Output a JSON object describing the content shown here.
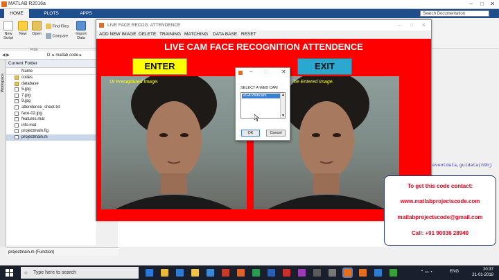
{
  "app": {
    "title": "MATLAB R2016a"
  },
  "ribbon": {
    "tabs": [
      "HOME",
      "PLOTS",
      "APPS"
    ],
    "search_placeholder": "Search Documentation",
    "buttons": [
      {
        "label": "New Script",
        "icon": "new-script-icon"
      },
      {
        "label": "New",
        "icon": "new-icon"
      },
      {
        "label": "Open",
        "icon": "open-folder-icon"
      },
      {
        "label": "Find Files",
        "icon": "find-files-icon"
      },
      {
        "label": "Compare",
        "icon": "compare-icon"
      },
      {
        "label": "Import Data",
        "icon": "import-data-icon"
      }
    ],
    "group_label": "FILE"
  },
  "address": {
    "path": "D: ▸ matlab code ▸"
  },
  "sidebar": {
    "workspace_tab": "Workspace"
  },
  "current_folder": {
    "title": "Current Folder",
    "column_header": "Name",
    "items": [
      {
        "name": "codes",
        "type": "folder"
      },
      {
        "name": "database",
        "type": "folder"
      },
      {
        "name": "5.jpg",
        "type": "file"
      },
      {
        "name": "7.jpg",
        "type": "file"
      },
      {
        "name": "9.jpg",
        "type": "file"
      },
      {
        "name": "attendence_sheet.txt",
        "type": "file"
      },
      {
        "name": "face-02.jpg",
        "type": "file"
      },
      {
        "name": "features.mat",
        "type": "file"
      },
      {
        "name": "info.mat",
        "type": "file"
      },
      {
        "name": "projectmain.fig",
        "type": "file"
      },
      {
        "name": "projectmain.m",
        "type": "file",
        "selected": true
      }
    ],
    "details": "projectmain.m  (Function)"
  },
  "command_window": {
    "code_text": ",eventdata,guidata(hObj"
  },
  "figure": {
    "title": "LIVE FACE RECOG. ATTENDENCE",
    "menu": [
      "ADD NEW IMAGE",
      "DELETE",
      "TRAINING",
      "MATCHING",
      "DATA BASE",
      "RESET"
    ],
    "heading": "LIVE CAM FACE RECOGNITION ATTENDENCE",
    "enter_label": "ENTER",
    "exit_label": "EXIT",
    "left_caption": "Ur Precaptured Image.",
    "right_caption": "he Entered Image.",
    "colors": {
      "canvas": "#ff0000",
      "enter": "#ffff00",
      "exit": "#2aa8d0",
      "caption": "#ffff33"
    }
  },
  "dialog": {
    "label": "SELECT A WEB CAM",
    "option": "VGA Webcam",
    "ok": "OK",
    "cancel": "Cancel"
  },
  "contact": {
    "line1": "To get this code contact:",
    "line2": "www.matlabprojectscode.com",
    "line3": "matlabprojectscode@gmail.com",
    "line4": "Call: +91 90036 28940"
  },
  "taskbar": {
    "search_placeholder": "Type here to search",
    "language": "ENG",
    "time": "20:37",
    "date": "21-01-2018"
  }
}
